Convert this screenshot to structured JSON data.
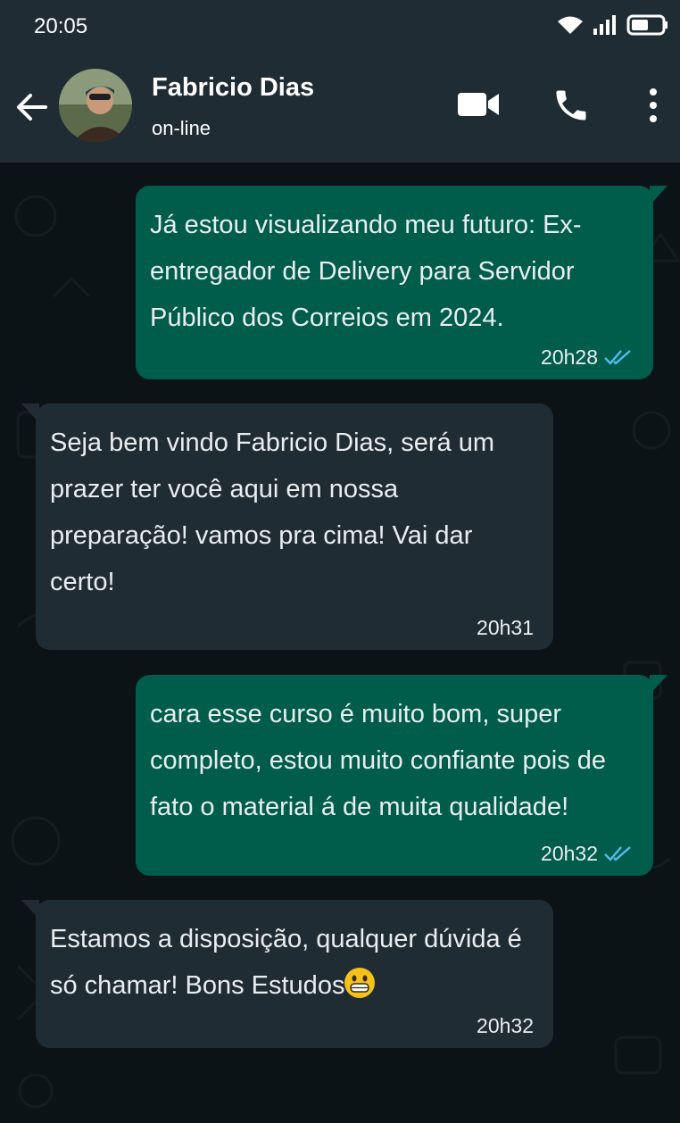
{
  "status_bar": {
    "time": "20:05"
  },
  "header": {
    "contact_name": "Fabricio Dias",
    "contact_status": "on-line"
  },
  "messages": [
    {
      "direction": "out",
      "text": "Já estou visualizando meu futuro: Ex-entregador de Delivery para Servidor Público dos Correios em 2024.",
      "time": "20h28",
      "read": true
    },
    {
      "direction": "in",
      "text": "Seja bem vindo Fabricio Dias, será um prazer ter você aqui em nossa preparação! vamos pra cima! Vai dar certo!",
      "time": "20h31"
    },
    {
      "direction": "out",
      "text": "cara esse curso é muito bom, super completo, estou muito confiante pois de fato o material á de muita qualidade!",
      "time": "20h32",
      "read": true
    },
    {
      "direction": "in",
      "text": "Estamos a disposição, qualquer dúvida é só chamar! Bons Estudos",
      "emoji": "grinning-face-emoji",
      "time": "20h32"
    }
  ],
  "colors": {
    "header_bg": "#1f2c34",
    "chat_bg": "#0c1317",
    "outgoing_bubble": "#005c4b",
    "incoming_bubble": "#202c33",
    "read_tick": "#53bdeb",
    "text": "#e9edef"
  },
  "icons": [
    "wifi-icon",
    "signal-icon",
    "battery-icon",
    "back-arrow-icon",
    "video-call-icon",
    "phone-icon",
    "more-options-icon",
    "double-check-icon"
  ]
}
